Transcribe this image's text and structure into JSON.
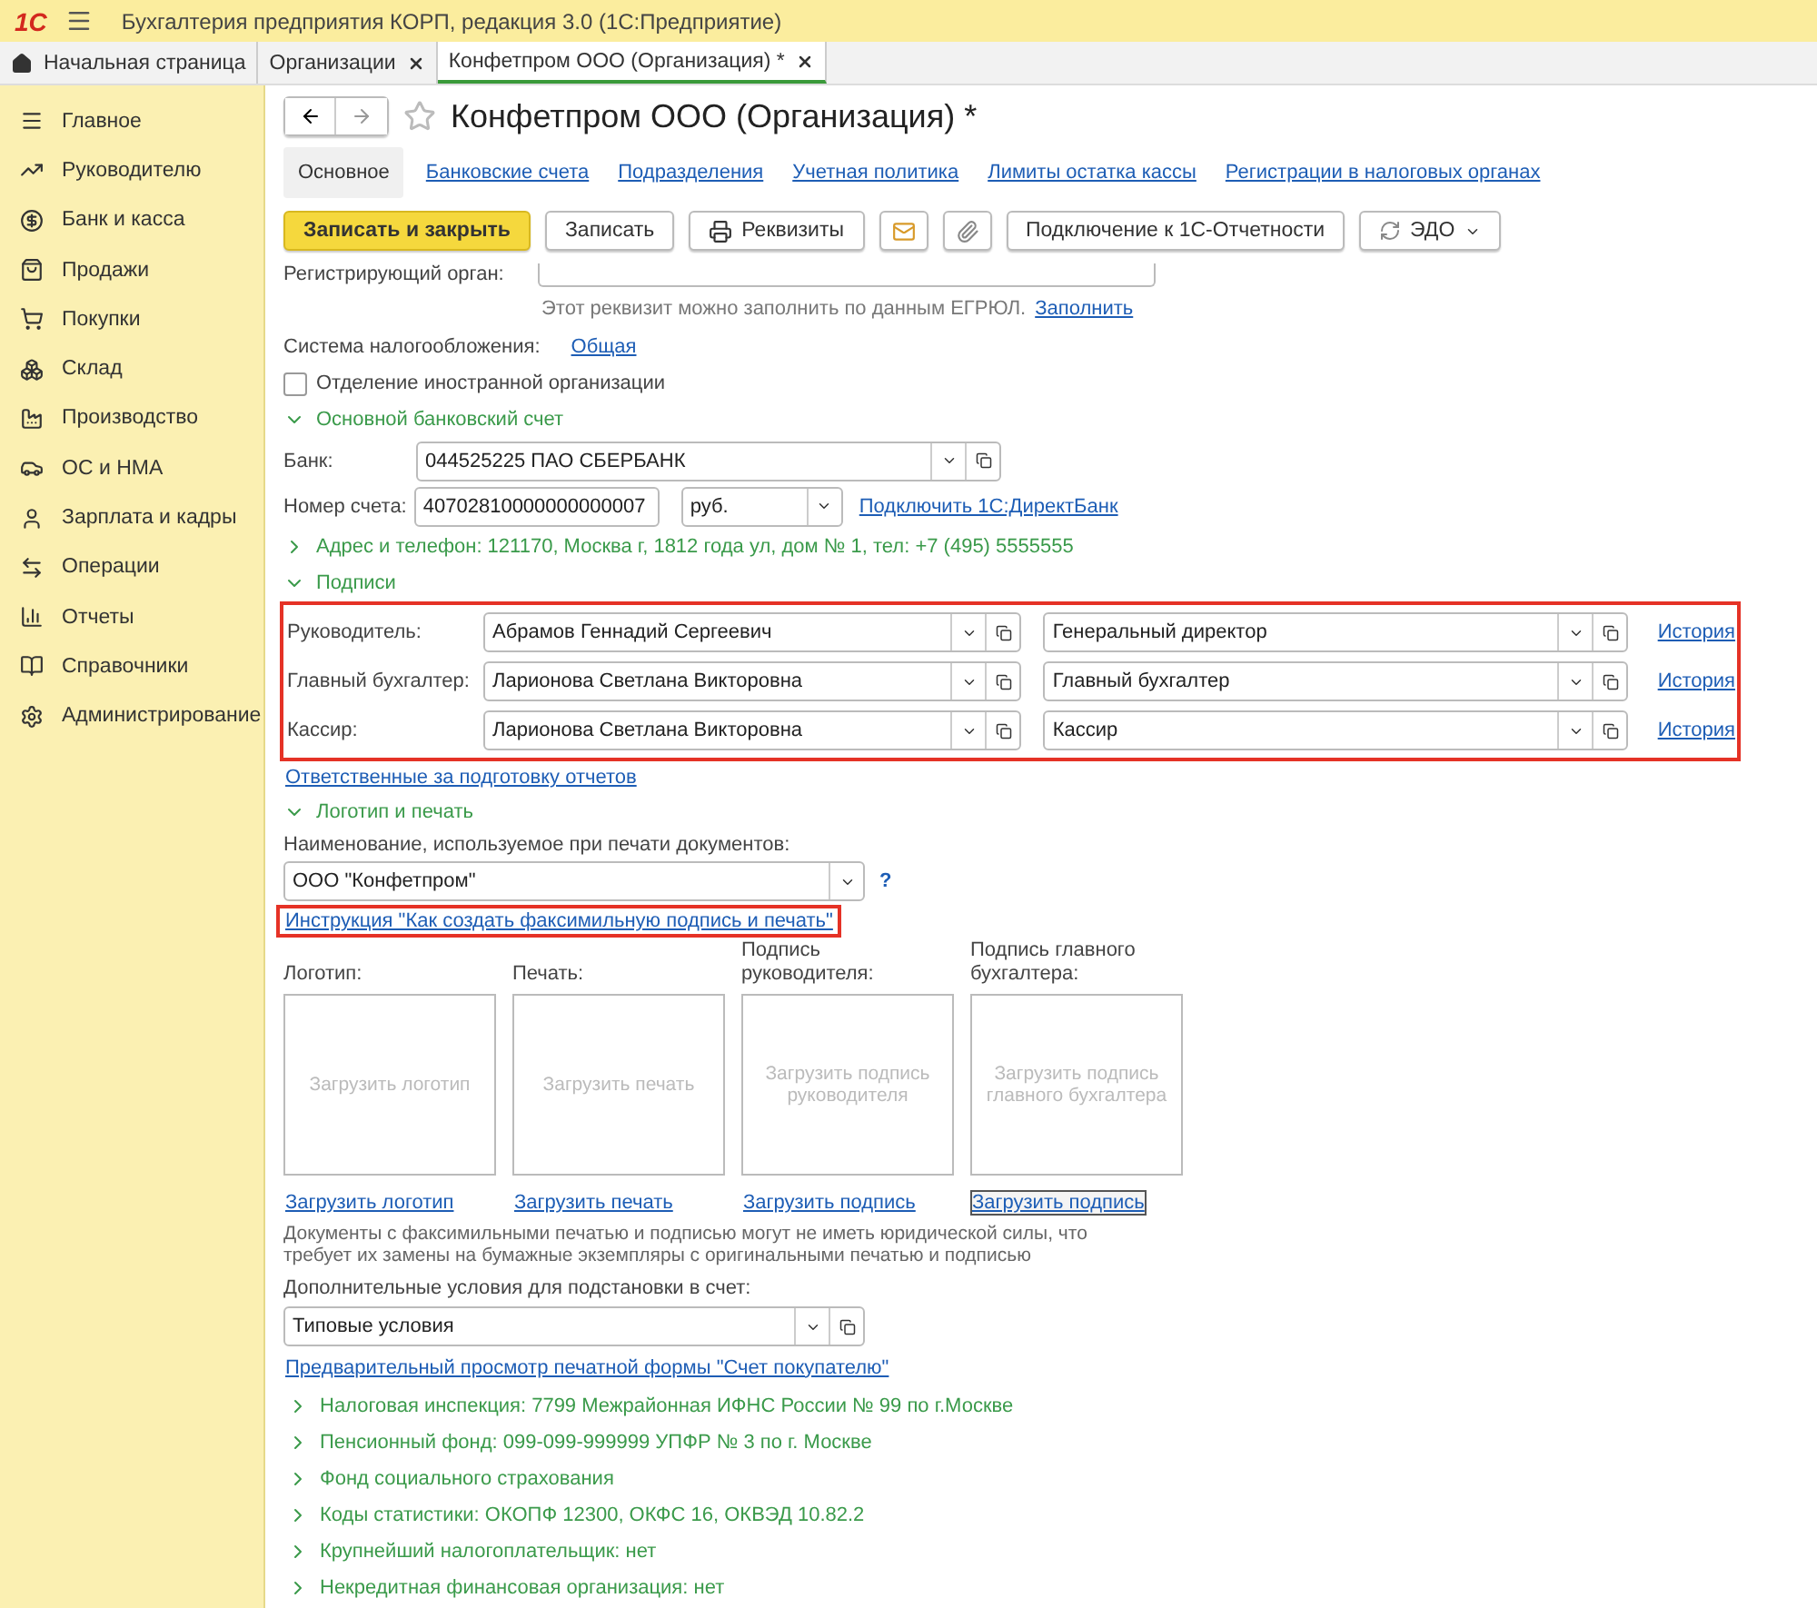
{
  "app_title": "Бухгалтерия предприятия КОРП, редакция 3.0  (1С:Предприятие)",
  "logo": "1С",
  "tabs": [
    {
      "label": "Начальная страница",
      "kind": "home",
      "selected": false
    },
    {
      "label": "Организации",
      "kind": "closable",
      "selected": false
    },
    {
      "label": "Конфетпром ООО (Организация) *",
      "kind": "closable",
      "selected": true
    }
  ],
  "sidebar": {
    "items": [
      {
        "label": "Главное"
      },
      {
        "label": "Руководителю"
      },
      {
        "label": "Банк и касса"
      },
      {
        "label": "Продажи"
      },
      {
        "label": "Покупки"
      },
      {
        "label": "Склад"
      },
      {
        "label": "Производство"
      },
      {
        "label": "ОС и НМА"
      },
      {
        "label": "Зарплата и кадры"
      },
      {
        "label": "Операции"
      },
      {
        "label": "Отчеты"
      },
      {
        "label": "Справочники"
      },
      {
        "label": "Администрирование"
      }
    ]
  },
  "form": {
    "title": "Конфетпром ООО (Организация) *",
    "favorite": false,
    "sections": [
      {
        "label": "Основное",
        "selected": true
      },
      {
        "label": "Банковские счета",
        "selected": false
      },
      {
        "label": "Подразделения",
        "selected": false
      },
      {
        "label": "Учетная политика",
        "selected": false
      },
      {
        "label": "Лимиты остатка кассы",
        "selected": false
      },
      {
        "label": "Регистрации в налоговых органах",
        "selected": false
      }
    ],
    "toolbar": [
      {
        "kind": "primary",
        "label": "Записать и закрыть"
      },
      {
        "kind": "plain",
        "label": "Записать"
      },
      {
        "kind": "print",
        "label": "Реквизиты"
      },
      {
        "kind": "mail"
      },
      {
        "kind": "clip"
      },
      {
        "kind": "plain",
        "label": "Подключение к 1С-Отчетности"
      },
      {
        "kind": "menu",
        "label": "ЭДО"
      }
    ],
    "registrar": {
      "label": "Регистрирующий орган:",
      "hint": "Этот реквизит можно заполнить по данным ЕГРЮЛ.",
      "link": "Заполнить"
    },
    "tax_system": {
      "label": "Система налогообложения:",
      "value": "Общая"
    },
    "foreign_branch": {
      "label": "Отделение иностранной организации",
      "checked": false
    },
    "bank_section": {
      "title": "Основной банковский счет",
      "expanded": true,
      "bank": {
        "label": "Банк:",
        "value": "044525225 ПАО СБЕРБАНК"
      },
      "account": {
        "label": "Номер счета:",
        "value": "40702810000000000007",
        "currency": "руб.",
        "link": "Подключить 1С:ДиректБанк"
      }
    },
    "address_section": {
      "title": "Адрес и телефон: 121170, Москва г, 1812 года ул, дом № 1, тел: +7 (495) 5555555",
      "expanded": false
    },
    "signatures": {
      "title": "Подписи",
      "expanded": true,
      "highlighted": true,
      "rows": [
        {
          "label": "Руководитель:",
          "person": "Абрамов Геннадий Сергеевич",
          "position": "Генеральный директор",
          "link": "История"
        },
        {
          "label": "Главный бухгалтер:",
          "person": "Ларионова Светлана Викторовна",
          "position": "Главный бухгалтер",
          "link": "История"
        },
        {
          "label": "Кассир:",
          "person": "Ларионова Светлана Викторовна",
          "position": "Кассир",
          "link": "История"
        }
      ]
    },
    "responsible_link": "Ответственные за подготовку отчетов",
    "logo_section": {
      "title": "Логотип и печать",
      "expanded": true,
      "name_label": "Наименование, используемое при печати документов:",
      "name_value": "ООО \"Конфетпром\"",
      "help": "?",
      "instruction": {
        "text": "Инструкция \"Как создать факсимильную подпись и печать\"",
        "highlighted": true
      },
      "images": [
        {
          "label": "Логотип:",
          "placeholder": "Загрузить логотип",
          "link": "Загрузить логотип",
          "focused": false
        },
        {
          "label": "Печать:",
          "placeholder": "Загрузить печать",
          "link": "Загрузить печать",
          "focused": false
        },
        {
          "label": "Подпись руководителя:",
          "placeholder": "Загрузить подпись руководителя",
          "link": "Загрузить подпись",
          "focused": false
        },
        {
          "label": "Подпись главного бухгалтера:",
          "placeholder": "Загрузить подпись главного бухгалтера",
          "link": "Загрузить подпись",
          "focused": true
        }
      ],
      "note": "Документы с факсимильными печатью и подписью могут не иметь юридической силы, что требует их замены на бумажные экземпляры с оригинальными печатью и подписью"
    },
    "conditions": {
      "label": "Дополнительные условия для подстановки в счет:",
      "value": "Типовые условия"
    },
    "preview_link": "Предварительный просмотр печатной формы \"Счет покупателю\"",
    "groups": [
      {
        "title": "Налоговая инспекция: 7799 Межрайонная ИФНС России № 99 по г.Москве",
        "expanded": false
      },
      {
        "title": "Пенсионный фонд: 099-099-999999 УПФР № 3 по г. Москве",
        "expanded": false
      },
      {
        "title": "Фонд социального страхования",
        "expanded": false
      },
      {
        "title": "Коды статистики: ОКОПФ 12300, ОКФС 16, ОКВЭД 10.82.2",
        "expanded": false
      },
      {
        "title": "Крупнейший налогоплательщик: нет",
        "expanded": false
      },
      {
        "title": "Некредитная финансовая организация: нет",
        "expanded": false
      }
    ]
  }
}
